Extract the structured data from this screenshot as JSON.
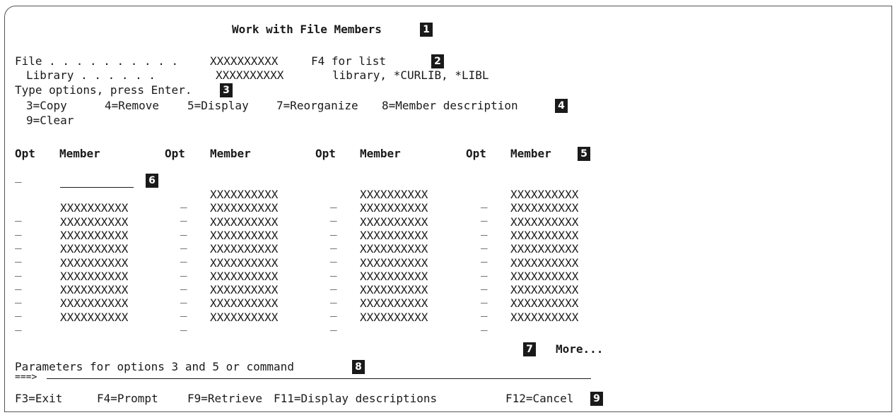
{
  "title": "Work with File Members",
  "file": {
    "label": "File . . . . . . . . . .",
    "value": "XXXXXXXXXX",
    "hint": "F4 for list"
  },
  "library": {
    "label": "Library . . . . . .",
    "value": "XXXXXXXXXX",
    "hint": "library, *CURLIB, *LIBL"
  },
  "instructions": "Type options, press Enter.",
  "options_line1": [
    "3=Copy",
    "4=Remove",
    "5=Display",
    "7=Reorganize",
    "8=Member description"
  ],
  "options_line2": [
    "9=Clear"
  ],
  "columns": [
    {
      "opt": "Opt",
      "member": "Member"
    },
    {
      "opt": "Opt",
      "member": "Member"
    },
    {
      "opt": "Opt",
      "member": "Member"
    },
    {
      "opt": "Opt",
      "member": "Member"
    }
  ],
  "opt_placeholder": "_",
  "members": [
    [
      "XXXXXXXXXX",
      "XXXXXXXXXX",
      "XXXXXXXXXX",
      "XXXXXXXXXX",
      "XXXXXXXXXX",
      "XXXXXXXXXX",
      "XXXXXXXXXX",
      "XXXXXXXXXX",
      "XXXXXXXXXX"
    ],
    [
      "XXXXXXXXXX",
      "XXXXXXXXXX",
      "XXXXXXXXXX",
      "XXXXXXXXXX",
      "XXXXXXXXXX",
      "XXXXXXXXXX",
      "XXXXXXXXXX",
      "XXXXXXXXXX",
      "XXXXXXXXXX",
      "XXXXXXXXXX"
    ],
    [
      "XXXXXXXXXX",
      "XXXXXXXXXX",
      "XXXXXXXXXX",
      "XXXXXXXXXX",
      "XXXXXXXXXX",
      "XXXXXXXXXX",
      "XXXXXXXXXX",
      "XXXXXXXXXX",
      "XXXXXXXXXX",
      "XXXXXXXXXX"
    ],
    [
      "XXXXXXXXXX",
      "XXXXXXXXXX",
      "XXXXXXXXXX",
      "XXXXXXXXXX",
      "XXXXXXXXXX",
      "XXXXXXXXXX",
      "XXXXXXXXXX",
      "XXXXXXXXXX",
      "XXXXXXXXXX",
      "XXXXXXXXXX"
    ]
  ],
  "more": "More...",
  "parameters_label": "Parameters for options 3 and 5 or command",
  "command_prompt": "===>",
  "function_keys": [
    "F3=Exit",
    "F4=Prompt",
    "F9=Retrieve",
    "F11=Display descriptions",
    "F12=Cancel"
  ],
  "callouts": [
    "1",
    "2",
    "3",
    "4",
    "5",
    "6",
    "7",
    "8",
    "9"
  ]
}
